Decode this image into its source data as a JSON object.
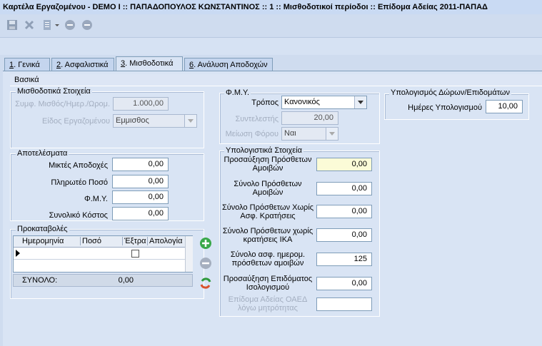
{
  "window": {
    "title": "Καρτέλα Εργαζομένου - DEMO I :: ΠΑΠΑΔΟΠΟΥΛΟΣ ΚΩΝΣΤΑΝΤΙΝΟΣ  :: 1  :: Μισθοδοτικοί περίοδοι :: Επίδομα Αδείας 2011-ΠΑΠΑΔ"
  },
  "tabs": [
    {
      "num": "1",
      "label": ". Γενικά"
    },
    {
      "num": "2",
      "label": ". Ασφαλιστικά"
    },
    {
      "num": "3",
      "label": ". Μισθοδοτικά"
    },
    {
      "num": "6",
      "label": ". Ανάλυση Αποδοχών"
    }
  ],
  "subheader": "Βασικά",
  "salary": {
    "title": "Μισθοδοτικά Στοιχεία",
    "wage_label": "Συμφ. Μισθός/Ημερ./Ωρομ.",
    "wage_value": "1.000,00",
    "type_label": "Είδος Εργαζομένου",
    "type_value": "Εμμισθος"
  },
  "fmy": {
    "title": "Φ.Μ.Υ.",
    "method_label": "Τρόπος",
    "method_value": "Κανονικός",
    "factor_label": "Συντελεστής",
    "factor_value": "20,00",
    "reduction_label": "Μείωση Φόρου",
    "reduction_value": "Ναι"
  },
  "bonus": {
    "title": "Υπολογισμός Δώρων/Επιδομάτων",
    "days_label": "Ημέρες Υπολογισμού",
    "days_value": "10,00"
  },
  "results": {
    "title": "Αποτελέσματα",
    "rows": [
      {
        "label": "Μικτές Αποδοχές",
        "value": "0,00"
      },
      {
        "label": "Πληρωτέο Ποσό",
        "value": "0,00"
      },
      {
        "label": "Φ.Μ.Υ.",
        "value": "0,00"
      },
      {
        "label": "Συνολικό Κόστος",
        "value": "0,00"
      }
    ]
  },
  "calc": {
    "title": "Υπολογιστικά Στοιχεία",
    "rows": [
      {
        "label": "Προσαύξηση Πρόσθετων Αμοιβών",
        "value": "0,00"
      },
      {
        "label": "Σύνολο Πρόσθετων Αμοιβών",
        "value": "0,00"
      },
      {
        "label": "Σύνολο Πρόσθετων Χωρίς Ασφ. Κρατήσεις",
        "value": "0,00"
      },
      {
        "label": "Σύνολο Πρόσθετων χωρίς κρατήσεις ΙΚΑ",
        "value": "0,00"
      },
      {
        "label": "Σύνολο ασφ. ημερομ. πρόσθετων αμοιβών",
        "value": "125"
      },
      {
        "label": "Προσαύξηση Επιδόματος Ισολογισμού",
        "value": "0,00"
      },
      {
        "label": "Επίδομα Αδείας ΟΑΕΔ λόγω μητρότητας",
        "value": ""
      }
    ]
  },
  "advances": {
    "title": "Προκαταβολές",
    "columns": [
      "Ημερομηνία",
      "Ποσό",
      "Έξτρα",
      "Απολογία"
    ],
    "total_label": "ΣΥΝΟΛΟ:",
    "total_value": "0,00"
  },
  "colors": {
    "tab_active": "#d9e4f4",
    "background": "#cfdcef",
    "highlight_field": "#fbfbd7"
  }
}
